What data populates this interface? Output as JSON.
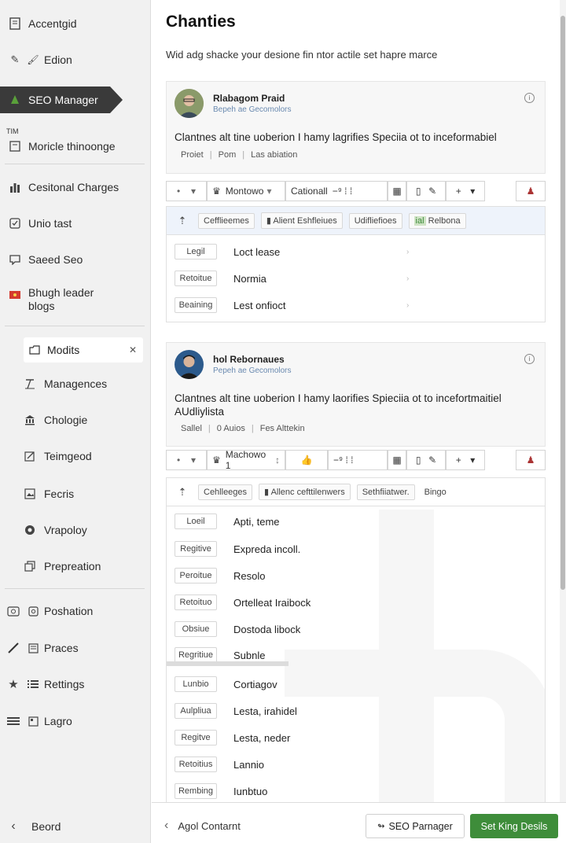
{
  "sidebar": {
    "top_items": [
      {
        "label": "Accentgid",
        "icon": "document-icon"
      },
      {
        "label": "Edion",
        "icon": "edit-icon"
      },
      {
        "label": "SEO Manager",
        "icon": "leaf-icon"
      },
      {
        "label": "Moricle thinoonge",
        "icon": "page-icon"
      },
      {
        "label": "Cesitonal Charges",
        "icon": "bar-chart-icon"
      },
      {
        "label": "Unio tast",
        "icon": "checklist-icon"
      },
      {
        "label": "Saeed Seo",
        "icon": "comment-icon"
      },
      {
        "label": "Bhugh leader blogs",
        "icon": "flag-icon"
      }
    ],
    "tim_label": "TIM",
    "sub_items": [
      {
        "label": "Modits",
        "icon": "folder-icon",
        "close": "✕"
      },
      {
        "label": "Managences",
        "icon": "text-icon"
      },
      {
        "label": "Chologie",
        "icon": "bank-icon"
      },
      {
        "label": "Teimgeod",
        "icon": "edit-box-icon"
      },
      {
        "label": "Fecris",
        "icon": "image-icon"
      },
      {
        "label": "Vrapoloy",
        "icon": "circle-icon"
      },
      {
        "label": "Prepreation",
        "icon": "copy-icon"
      }
    ],
    "bottom_items": [
      {
        "label": "Poshation",
        "icon": "camera-icon"
      },
      {
        "label": "Praces",
        "icon": "pen-icon"
      },
      {
        "label": "Rettings",
        "icon": "star-icon"
      },
      {
        "label": "Lagro",
        "icon": "menu-icon"
      }
    ],
    "footer_label": "Beord"
  },
  "header": {
    "title": "Chanties",
    "subtitle": "Wid adg shacke your desione fin ntor actile set hapre marce"
  },
  "posts": [
    {
      "name": "Rlabagom Praid",
      "meta": "Bepeh ae  Gecomolors",
      "body": "Clantnes alt tine uoberion I hamy lagrifies Speciia ot to inceformabiel",
      "tags": [
        "Proiet",
        "Pom",
        "Las abiation"
      ],
      "toolbar": {
        "dd1": "Montowo",
        "dd2": "Cationall"
      },
      "chips": [
        "Cefflieemes",
        "Alient Eshfleiues",
        "Udifliefioes",
        "Relbona"
      ],
      "rows": [
        {
          "label": "Legil",
          "text": "Loct lease"
        },
        {
          "label": "Retoitue",
          "text": "Normia"
        },
        {
          "label": "Beaining",
          "text": "Lest onfioct"
        }
      ]
    },
    {
      "name": "hol Rebornaues",
      "meta": "Pepeh ae  Gecomolors",
      "body": "Clantnes alt tine uoberion I hamy laorifies Spieciia ot to incefortmaitiel\nAUdliylista",
      "tags": [
        "Sallel",
        "0  Auios",
        "Fes Alttekin"
      ],
      "toolbar": {
        "dd1": "Machowo 1",
        "dd2": ""
      },
      "chips": [
        "Cehlleeges",
        "Allenc cefttilenwers",
        "Sethfiiatwer.",
        "Bingo"
      ],
      "rows": [
        {
          "label": "Loeil",
          "text": "Apti, teme"
        },
        {
          "label": "Regitive",
          "text": "Expreda incoll."
        },
        {
          "label": "Peroitue",
          "text": "Resolo"
        },
        {
          "label": "Retoituo",
          "text": "Ortelleat Iraibock"
        },
        {
          "label": "Obsiue",
          "text": "Dostoda libock"
        },
        {
          "label": "Regritiue",
          "text": "Subnle"
        },
        {
          "label": "Lunbio",
          "text": "Cortiagov"
        },
        {
          "label": "Aulpliua",
          "text": "Lesta, irahidel"
        },
        {
          "label": "Regitve",
          "text": "Lesta, neder"
        },
        {
          "label": "Retoitius",
          "text": "Lannio"
        },
        {
          "label": "Rembing",
          "text": "Iunbtuo"
        }
      ]
    }
  ],
  "footer": {
    "back_label": "Agol Contarnt",
    "outline_button": "SEO Parnager",
    "primary_button": "Set King Desils"
  },
  "colors": {
    "accent": "#3e8d3a",
    "active_bg": "#3a3a3a",
    "panel_header_bg": "#eef3fb"
  }
}
